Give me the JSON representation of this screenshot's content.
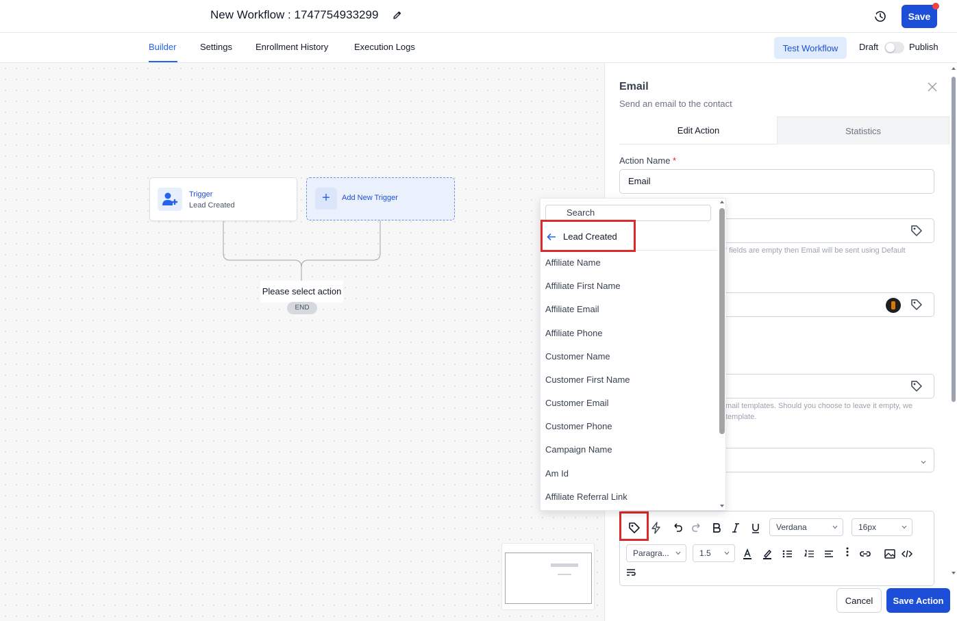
{
  "header": {
    "title": "New Workflow : 1747754933299",
    "save_label": "Save"
  },
  "nav": {
    "tabs": [
      "Builder",
      "Settings",
      "Enrollment History",
      "Execution Logs"
    ],
    "active_tab": "Builder",
    "test_workflow_label": "Test Workflow",
    "draft_label": "Draft",
    "publish_label": "Publish"
  },
  "canvas": {
    "trigger": {
      "title": "Trigger",
      "subtitle": "Lead Created"
    },
    "add_trigger_label": "Add New Trigger",
    "select_action_label": "Please select action",
    "end_label": "END"
  },
  "panel": {
    "title": "Email",
    "subtitle": "Send an email to the contact",
    "tabs": [
      "Edit Action",
      "Statistics"
    ],
    "action_name_label": "Action Name",
    "action_name_value": "Email",
    "hint1": "' fields are empty then Email will be sent using Default",
    "hint2_line1": "mail templates. Should you choose to leave it empty, we",
    "hint2_line2": "template.",
    "editor": {
      "font": "Verdana",
      "size": "16px",
      "block": "Paragra...",
      "line_height": "1.5"
    },
    "cancel_label": "Cancel",
    "save_action_label": "Save Action"
  },
  "dropdown": {
    "search_placeholder": "Search",
    "back_label": "Lead Created",
    "items": [
      "Affiliate Name",
      "Affiliate First Name",
      "Affiliate Email",
      "Affiliate Phone",
      "Customer Name",
      "Customer First Name",
      "Customer Email",
      "Customer Phone",
      "Campaign Name",
      "Am Id",
      "Affiliate Referral Link"
    ]
  },
  "colors": {
    "primary": "#1d4ed8",
    "highlight": "#d92b2b"
  }
}
